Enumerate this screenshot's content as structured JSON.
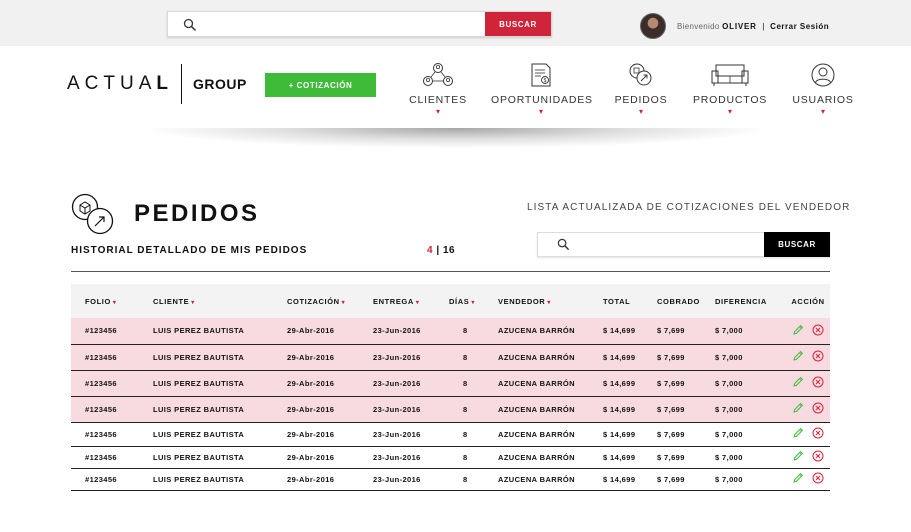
{
  "topbar": {
    "search_placeholder": "",
    "search_button": "BUSCAR",
    "welcome_prefix": "Bienvenido",
    "user_name": "OLIVER",
    "separator": "|",
    "logout": "Cerrar Sesión"
  },
  "header": {
    "logo_brand_light": "ACTUA",
    "logo_brand_bold": "L",
    "logo_group": "GROUP",
    "new_quote_button": "+ COTIZACIÓN",
    "nav": [
      {
        "label": "CLIENTES",
        "icon": "clients-icon"
      },
      {
        "label": "OPORTUNIDADES",
        "icon": "document-icon"
      },
      {
        "label": "PEDIDOS",
        "icon": "orders-icon"
      },
      {
        "label": "PRODUCTOS",
        "icon": "sofa-icon"
      },
      {
        "label": "USUARIOS",
        "icon": "user-icon"
      }
    ]
  },
  "main": {
    "title": "PEDIDOS",
    "subtitle": "HISTORIAL DETALLADO DE MIS PEDIDOS",
    "page_current": "4",
    "page_sep": "|",
    "page_total": "16",
    "list_caption": "LISTA ACTUALIZADA DE COTIZACIONES DEL VENDEDOR",
    "search_placeholder": "",
    "search_button": "BUSCAR"
  },
  "table": {
    "columns": [
      {
        "label": "FOLIO",
        "sortable": true
      },
      {
        "label": "CLIENTE",
        "sortable": true
      },
      {
        "label": "COTIZACIÓN",
        "sortable": true
      },
      {
        "label": "ENTREGA",
        "sortable": true
      },
      {
        "label": "DÍAS",
        "sortable": true
      },
      {
        "label": "VENDEDOR",
        "sortable": true
      },
      {
        "label": "TOTAL",
        "sortable": false
      },
      {
        "label": "COBRADO",
        "sortable": false
      },
      {
        "label": "DIFERENCIA",
        "sortable": false
      },
      {
        "label": "ACCIÓN",
        "sortable": false
      }
    ],
    "rows": [
      {
        "folio": "#123456",
        "cliente": "LUIS PEREZ BAUTISTA",
        "cotizacion": "29-Abr-2016",
        "entrega": "23-Jun-2016",
        "dias": "8",
        "vendedor": "AZUCENA BARRÓN",
        "total": "$ 14,699",
        "cobrado": "$ 7,699",
        "diferencia": "$ 7,000",
        "highlight": true
      },
      {
        "folio": "#123456",
        "cliente": "LUIS PEREZ BAUTISTA",
        "cotizacion": "29-Abr-2016",
        "entrega": "23-Jun-2016",
        "dias": "8",
        "vendedor": "AZUCENA BARRÓN",
        "total": "$ 14,699",
        "cobrado": "$ 7,699",
        "diferencia": "$ 7,000",
        "highlight": true
      },
      {
        "folio": "#123456",
        "cliente": "LUIS PEREZ BAUTISTA",
        "cotizacion": "29-Abr-2016",
        "entrega": "23-Jun-2016",
        "dias": "8",
        "vendedor": "AZUCENA BARRÓN",
        "total": "$ 14,699",
        "cobrado": "$ 7,699",
        "diferencia": "$ 7,000",
        "highlight": true
      },
      {
        "folio": "#123456",
        "cliente": "LUIS PEREZ BAUTISTA",
        "cotizacion": "29-Abr-2016",
        "entrega": "23-Jun-2016",
        "dias": "8",
        "vendedor": "AZUCENA BARRÓN",
        "total": "$ 14,699",
        "cobrado": "$ 7,699",
        "diferencia": "$ 7,000",
        "highlight": true
      },
      {
        "folio": "#123456",
        "cliente": "LUIS PEREZ BAUTISTA",
        "cotizacion": "29-Abr-2016",
        "entrega": "23-Jun-2016",
        "dias": "8",
        "vendedor": "AZUCENA BARRÓN",
        "total": "$ 14,699",
        "cobrado": "$ 7,699",
        "diferencia": "$ 7,000",
        "highlight": false
      },
      {
        "folio": "#123456",
        "cliente": "LUIS PEREZ BAUTISTA",
        "cotizacion": "29-Abr-2016",
        "entrega": "23-Jun-2016",
        "dias": "8",
        "vendedor": "AZUCENA BARRÓN",
        "total": "$ 14,699",
        "cobrado": "$ 7,699",
        "diferencia": "$ 7,000",
        "highlight": false
      },
      {
        "folio": "#123456",
        "cliente": "LUIS PEREZ BAUTISTA",
        "cotizacion": "29-Abr-2016",
        "entrega": "23-Jun-2016",
        "dias": "8",
        "vendedor": "AZUCENA BARRÓN",
        "total": "$ 14,699",
        "cobrado": "$ 7,699",
        "diferencia": "$ 7,000",
        "highlight": false
      }
    ],
    "sort_icon": "chevron-down-icon",
    "edit_icon": "pencil-icon",
    "delete_icon": "close-circle-icon"
  },
  "colors": {
    "accent_red": "#d0243a",
    "accent_green": "#3fbb3a",
    "highlight_row": "#f8dbe0",
    "topbar_bg": "#f1f1f1"
  }
}
